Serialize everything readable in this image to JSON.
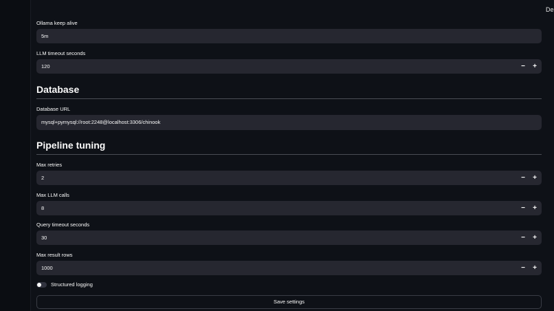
{
  "header": {
    "deploy_label": "Deploy"
  },
  "fields_top": [
    {
      "label": "Ollama keep alive",
      "value": "5m",
      "stepper": false
    },
    {
      "label": "LLM timeout seconds",
      "value": "120",
      "stepper": true
    }
  ],
  "database": {
    "heading": "Database",
    "url_label": "Database URL",
    "url_value": "mysql+pymysql://root:2248@localhost:3306/chinook"
  },
  "pipeline": {
    "heading": "Pipeline tuning",
    "fields": [
      {
        "label": "Max retries",
        "value": "2"
      },
      {
        "label": "Max LLM calls",
        "value": "8"
      },
      {
        "label": "Query timeout seconds",
        "value": "30"
      },
      {
        "label": "Max result rows",
        "value": "1000"
      }
    ]
  },
  "stepper": {
    "minus": "−",
    "plus": "+"
  },
  "toggle": {
    "label": "Structured logging",
    "on": false
  },
  "save_label": "Save settings"
}
